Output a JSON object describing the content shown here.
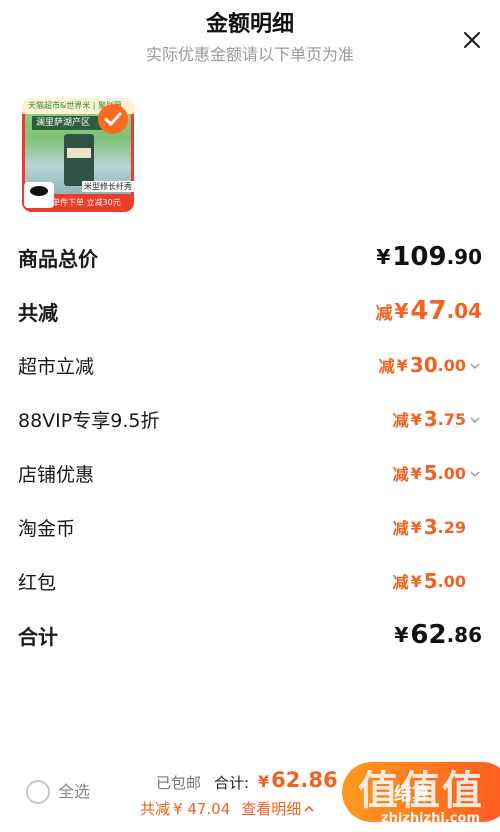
{
  "header": {
    "title": "金额明细",
    "subtitle": "实际优惠金额请以下单页为准",
    "close_icon": "close-icon"
  },
  "product": {
    "image_texts": {
      "top_band": "天猫超市&世界米 | 聚划算",
      "banner": "澜里萨湖产区",
      "bottom_bar": "单件下单 立减30元",
      "mini_label": "米型修长纤秀",
      "badge_icon": "tmall-cat-icon"
    },
    "selected_icon": "check-icon"
  },
  "rows": [
    {
      "label": "商品总价",
      "prefix": "",
      "yen": "¥",
      "int": "109",
      "dec": ".90",
      "style": "black",
      "big": true,
      "chevron": false
    },
    {
      "label": "共减",
      "prefix": "减",
      "yen": "¥",
      "int": "47",
      "dec": ".04",
      "style": "orange",
      "big": true,
      "chevron": false
    },
    {
      "label": "超市立减",
      "prefix": "减",
      "yen": "¥",
      "int": "30",
      "dec": ".00",
      "style": "orange",
      "big": false,
      "chevron": true
    },
    {
      "label": "88VIP专享9.5折",
      "prefix": "减",
      "yen": "¥",
      "int": "3",
      "dec": ".75",
      "style": "orange",
      "big": false,
      "chevron": true
    },
    {
      "label": "店铺优惠",
      "prefix": "减",
      "yen": "¥",
      "int": "5",
      "dec": ".00",
      "style": "orange",
      "big": false,
      "chevron": true
    },
    {
      "label": "淘金币",
      "prefix": "减",
      "yen": "¥",
      "int": "3",
      "dec": ".29",
      "style": "orange",
      "big": false,
      "chevron": false
    },
    {
      "label": "红包",
      "prefix": "减",
      "yen": "¥",
      "int": "5",
      "dec": ".00",
      "style": "orange",
      "big": false,
      "chevron": false
    },
    {
      "label": "合计",
      "prefix": "",
      "yen": "¥",
      "int": "62",
      "dec": ".86",
      "style": "black",
      "big": true,
      "chevron": false
    }
  ],
  "footer": {
    "select_all": "全选",
    "free_shipping": "已包邮",
    "total_label": "合计:",
    "total_yen": "¥",
    "total_value": "62.86",
    "savings_label": "共减",
    "savings_value": "¥ 47.04",
    "detail_link": "查看明细",
    "checkout_label": "结算",
    "watermark_logo": "值值值",
    "watermark_url": "zhizhizhi.com"
  },
  "colors": {
    "accent": "#f26322",
    "checkout_start": "#ff9a1f",
    "checkout_end": "#ff5a1f"
  }
}
